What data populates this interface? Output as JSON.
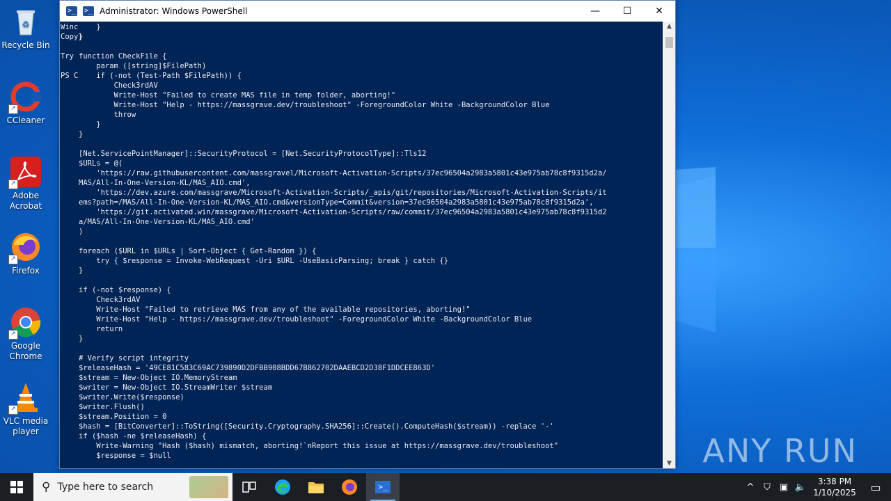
{
  "desktop": {
    "icons": [
      {
        "label": "Recycle Bin"
      },
      {
        "label": "CCleaner"
      },
      {
        "label": "Adobe Acrobat"
      },
      {
        "label": "Firefox"
      },
      {
        "label": "Google Chrome"
      },
      {
        "label": "VLC media player"
      }
    ],
    "watermark": "ANY RUN"
  },
  "window": {
    "title": "Administrator: Windows PowerShell",
    "left_column": [
      "Winc",
      "Copy}",
      "",
      "Try",
      "",
      "PS C"
    ],
    "code_lines": [
      "    }",
      "}",
      "",
      "function CheckFile {",
      "    param ([string]$FilePath)",
      "    if (-not (Test-Path $FilePath)) {",
      "        Check3rdAV",
      "        Write-Host \"Failed to create MAS file in temp folder, aborting!\"",
      "        Write-Host \"Help - https://massgrave.dev/troubleshoot\" -ForegroundColor White -BackgroundColor Blue",
      "        throw",
      "    }",
      "}",
      "",
      "[Net.ServicePointManager]::SecurityProtocol = [Net.SecurityProtocolType]::Tls12",
      "$URLs = @(",
      "    'https://raw.githubusercontent.com/massgravel/Microsoft-Activation-Scripts/37ec96504a2983a5801c43e975ab78c8f9315d2a/",
      "MAS/All-In-One-Version-KL/MAS_AIO.cmd',",
      "    'https://dev.azure.com/massgrave/Microsoft-Activation-Scripts/_apis/git/repositories/Microsoft-Activation-Scripts/it",
      "ems?path=/MAS/All-In-One-Version-KL/MAS_AIO.cmd&versionType=Commit&version=37ec96504a2983a5801c43e975ab78c8f9315d2a',",
      "    'https://git.activated.win/massgrave/Microsoft-Activation-Scripts/raw/commit/37ec96504a2983a5801c43e975ab78c8f9315d2",
      "a/MAS/All-In-One-Version-KL/MAS_AIO.cmd'",
      ")",
      "",
      "foreach ($URL in $URLs | Sort-Object { Get-Random }) {",
      "    try { $response = Invoke-WebRequest -Uri $URL -UseBasicParsing; break } catch {}",
      "}",
      "",
      "if (-not $response) {",
      "    Check3rdAV",
      "    Write-Host \"Failed to retrieve MAS from any of the available repositories, aborting!\"",
      "    Write-Host \"Help - https://massgrave.dev/troubleshoot\" -ForegroundColor White -BackgroundColor Blue",
      "    return",
      "}",
      "",
      "# Verify script integrity",
      "$releaseHash = '49CE81C583C69AC739890D2DFBB908BDD67B862702DAAEBCD2D38F1DDCEE863D'",
      "$stream = New-Object IO.MemoryStream",
      "$writer = New-Object IO.StreamWriter $stream",
      "$writer.Write($response)",
      "$writer.Flush()",
      "$stream.Position = 0",
      "$hash = [BitConverter]::ToString([Security.Cryptography.SHA256]::Create().ComputeHash($stream)) -replace '-'",
      "if ($hash -ne $releaseHash) {",
      "    Write-Warning \"Hash ($hash) mismatch, aborting!`nReport this issue at https://massgrave.dev/troubleshoot\"",
      "    $response = $null"
    ]
  },
  "taskbar": {
    "search_placeholder": "Type here to search",
    "time": "3:38 PM",
    "date": "1/10/2025"
  }
}
